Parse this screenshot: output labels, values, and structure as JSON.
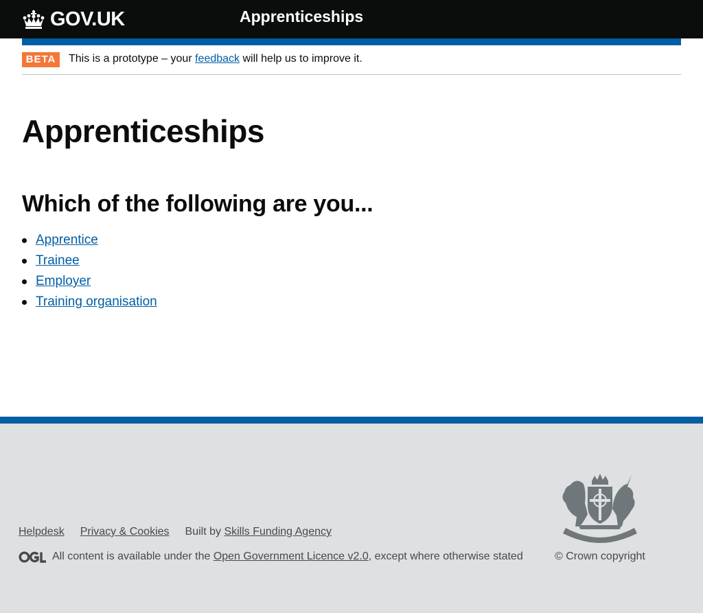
{
  "header": {
    "logo_text": "GOV.UK",
    "service_name": "Apprenticeships"
  },
  "phase_banner": {
    "tag": "BETA",
    "text_before": "This is a prototype – your ",
    "feedback_link": "feedback",
    "text_after": " will help us to improve it."
  },
  "main": {
    "title": "Apprenticeships",
    "question": "Which of the following are you...",
    "options": [
      {
        "label": "Apprentice"
      },
      {
        "label": "Trainee"
      },
      {
        "label": "Employer"
      },
      {
        "label": "Training organisation"
      }
    ]
  },
  "footer": {
    "links": {
      "helpdesk": "Helpdesk",
      "privacy": "Privacy & Cookies",
      "built_by_prefix": "Built by ",
      "built_by_link": "Skills Funding Agency"
    },
    "licence": {
      "ogl_logo": "OGL",
      "text_before": "All content is available under the ",
      "link": "Open Government Licence v2.0",
      "text_after": ", except where otherwise stated"
    },
    "crest_icon": "royal-coat-of-arms-icon",
    "copyright": "© Crown copyright"
  },
  "colors": {
    "header_bg": "#0b0c0c",
    "brand_blue": "#005ea5",
    "beta_orange": "#f47738",
    "footer_bg": "#dee0e2",
    "link": "#005ea5"
  }
}
